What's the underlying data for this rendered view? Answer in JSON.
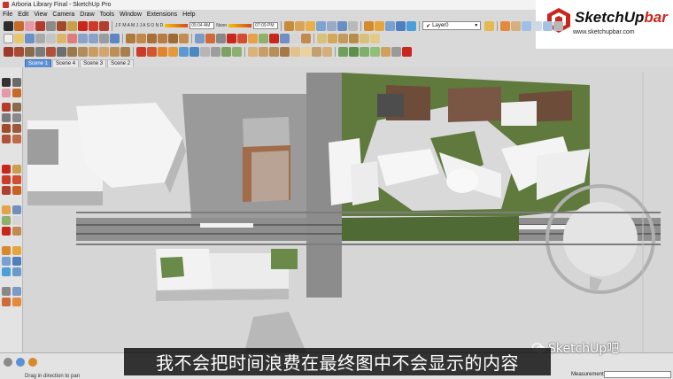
{
  "window": {
    "title": "Arboria Library Final - SketchUp Pro"
  },
  "menu": [
    "File",
    "Edit",
    "View",
    "Camera",
    "Draw",
    "Tools",
    "Window",
    "Extensions",
    "Help"
  ],
  "shadow": {
    "time1": "05:04 AM",
    "noon": "Noon",
    "time2": "07:09 PM",
    "months": "J F M A M J J A S O N D"
  },
  "layer": {
    "current": "Layer0"
  },
  "scenes": [
    {
      "label": "Scene 1",
      "active": true
    },
    {
      "label": "Scene 4",
      "active": false
    },
    {
      "label": "Scene 3",
      "active": false
    },
    {
      "label": "Scene 2",
      "active": false
    }
  ],
  "status": {
    "hint": "Drag in direction to pan",
    "measurements_label": "Measurements"
  },
  "logo": {
    "brand": "SketchUp",
    "suffix": "bar",
    "url": "www.sketchupbar.com"
  },
  "subtitle": "我不会把时间浪费在最终图中不会显示的内容",
  "watermark": "SketchUp吧",
  "colors": {
    "scene_active": "#5b8fd6",
    "brand_red": "#c9261c",
    "grass": "#5f7a3c"
  }
}
